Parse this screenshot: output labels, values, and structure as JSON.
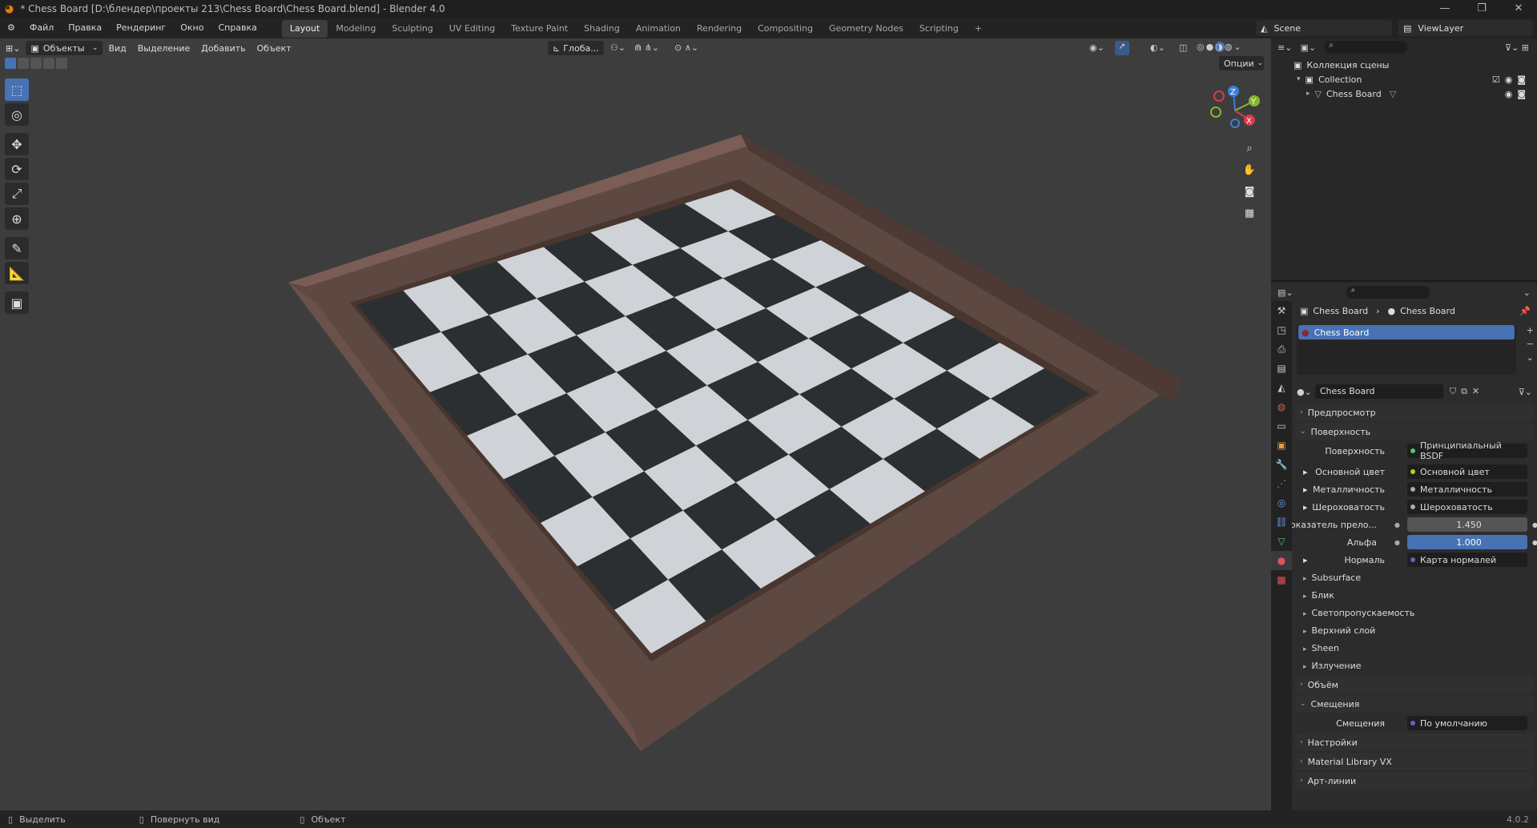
{
  "window": {
    "title": "* Chess Board [D:\\блендер\\проекты 213\\Chess Board\\Chess Board.blend] - Blender 4.0",
    "controls": [
      "—",
      "❐",
      "✕"
    ]
  },
  "menu": {
    "items": [
      "Файл",
      "Правка",
      "Рендеринг",
      "Окно",
      "Справка"
    ],
    "workspaces": [
      "Layout",
      "Modeling",
      "Sculpting",
      "UV Editing",
      "Texture Paint",
      "Shading",
      "Animation",
      "Rendering",
      "Compositing",
      "Geometry Nodes",
      "Scripting",
      "+"
    ],
    "scene": "Scene",
    "viewlayer": "ViewLayer"
  },
  "viewport": {
    "mode": "Объекты",
    "menus": [
      "Вид",
      "Выделение",
      "Добавить",
      "Объект"
    ],
    "orientation": "Глоба...",
    "options": "Опции",
    "gizmo": {
      "z": "Z",
      "y": "Y",
      "x": "X"
    }
  },
  "tools": [
    {
      "name": "select-box",
      "icon": "⬚"
    },
    {
      "name": "cursor",
      "icon": "◎"
    },
    {
      "name": "move",
      "icon": "✥"
    },
    {
      "name": "rotate",
      "icon": "⟳"
    },
    {
      "name": "scale",
      "icon": "⤢"
    },
    {
      "name": "transform",
      "icon": "⊕"
    },
    {
      "name": "annotate",
      "icon": "✎"
    },
    {
      "name": "measure",
      "icon": "📐"
    },
    {
      "name": "add-cube",
      "icon": "▣"
    }
  ],
  "outliner": {
    "root": "Коллекция сцены",
    "collection": "Collection",
    "object": "Chess Board"
  },
  "properties": {
    "breadcrumb": [
      "Chess Board",
      "Chess Board"
    ],
    "slot": "Chess Board",
    "material": "Chess Board",
    "sections": {
      "preview": "Предпросмотр",
      "surface": "Поверхность",
      "volume": "Объём",
      "displacement": "Смещения",
      "settings": "Настройки",
      "matlib": "Material Library VX",
      "lineart": "Арт-линии"
    },
    "surface_label": "Поверхность",
    "surface_value": "Принципиальный BSDF",
    "rows": [
      {
        "label": "Основной цвет",
        "value": "Основной цвет"
      },
      {
        "label": "Металличность",
        "value": "Металличность"
      },
      {
        "label": "Шероховатость",
        "value": "Шероховатость"
      }
    ],
    "ior_label": "Показатель прело...",
    "ior_value": "1.450",
    "alpha_label": "Альфа",
    "alpha_value": "1.000",
    "normal_label": "Нормаль",
    "normal_value": "Карта нормалей",
    "subpanels": [
      "Subsurface",
      "Блик",
      "Светопропускаемость",
      "Верхний слой",
      "Sheen",
      "Излучение"
    ],
    "disp_label": "Смещения",
    "disp_value": "По умолчанию"
  },
  "status": {
    "select": "Выделить",
    "rotate": "Повернуть вид",
    "object": "Объект",
    "version": "4.0.2"
  }
}
